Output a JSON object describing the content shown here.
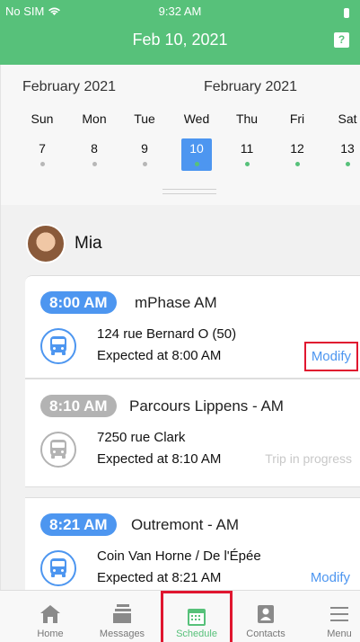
{
  "status": {
    "carrier": "No SIM",
    "time": "9:32 AM"
  },
  "header": {
    "title": "Feb 10, 2021",
    "help_icon": "help-icon"
  },
  "calendar": {
    "month_left": "February 2021",
    "month_right": "February 2021",
    "days": [
      {
        "dow": "Sun",
        "date": "7",
        "dot": "gray"
      },
      {
        "dow": "Mon",
        "date": "8",
        "dot": "gray"
      },
      {
        "dow": "Tue",
        "date": "9",
        "dot": "gray"
      },
      {
        "dow": "Wed",
        "date": "10",
        "dot": "green",
        "selected": true
      },
      {
        "dow": "Thu",
        "date": "11",
        "dot": "green"
      },
      {
        "dow": "Fri",
        "date": "12",
        "dot": "green"
      },
      {
        "dow": "Sat",
        "date": "13",
        "dot": "green"
      }
    ],
    "accent": "#4d96f0",
    "green": "#57c17a"
  },
  "person": {
    "name": "Mia"
  },
  "trips": [
    {
      "time": "8:00 AM",
      "route": "mPhase AM",
      "address": "124 rue Bernard O (50)",
      "expected": "Expected at 8:00 AM",
      "action": "Modify",
      "state": "active"
    },
    {
      "time": "8:10 AM",
      "route": "Parcours Lippens - AM",
      "address": "7250 rue Clark",
      "expected": "Expected at 8:10 AM",
      "action": "Trip in progress",
      "state": "inactive"
    },
    {
      "time": "8:21 AM",
      "route": "Outremont - AM",
      "address": "Coin Van Horne / De l'Épée",
      "expected": "Expected at 8:21 AM",
      "action": "Modify",
      "state": "active"
    }
  ],
  "tabs": [
    {
      "label": "Home",
      "icon": "home-icon"
    },
    {
      "label": "Messages",
      "icon": "messages-icon"
    },
    {
      "label": "Schedule",
      "icon": "calendar-icon",
      "active": true
    },
    {
      "label": "Contacts",
      "icon": "contacts-icon"
    },
    {
      "label": "Menu",
      "icon": "menu-icon"
    }
  ]
}
